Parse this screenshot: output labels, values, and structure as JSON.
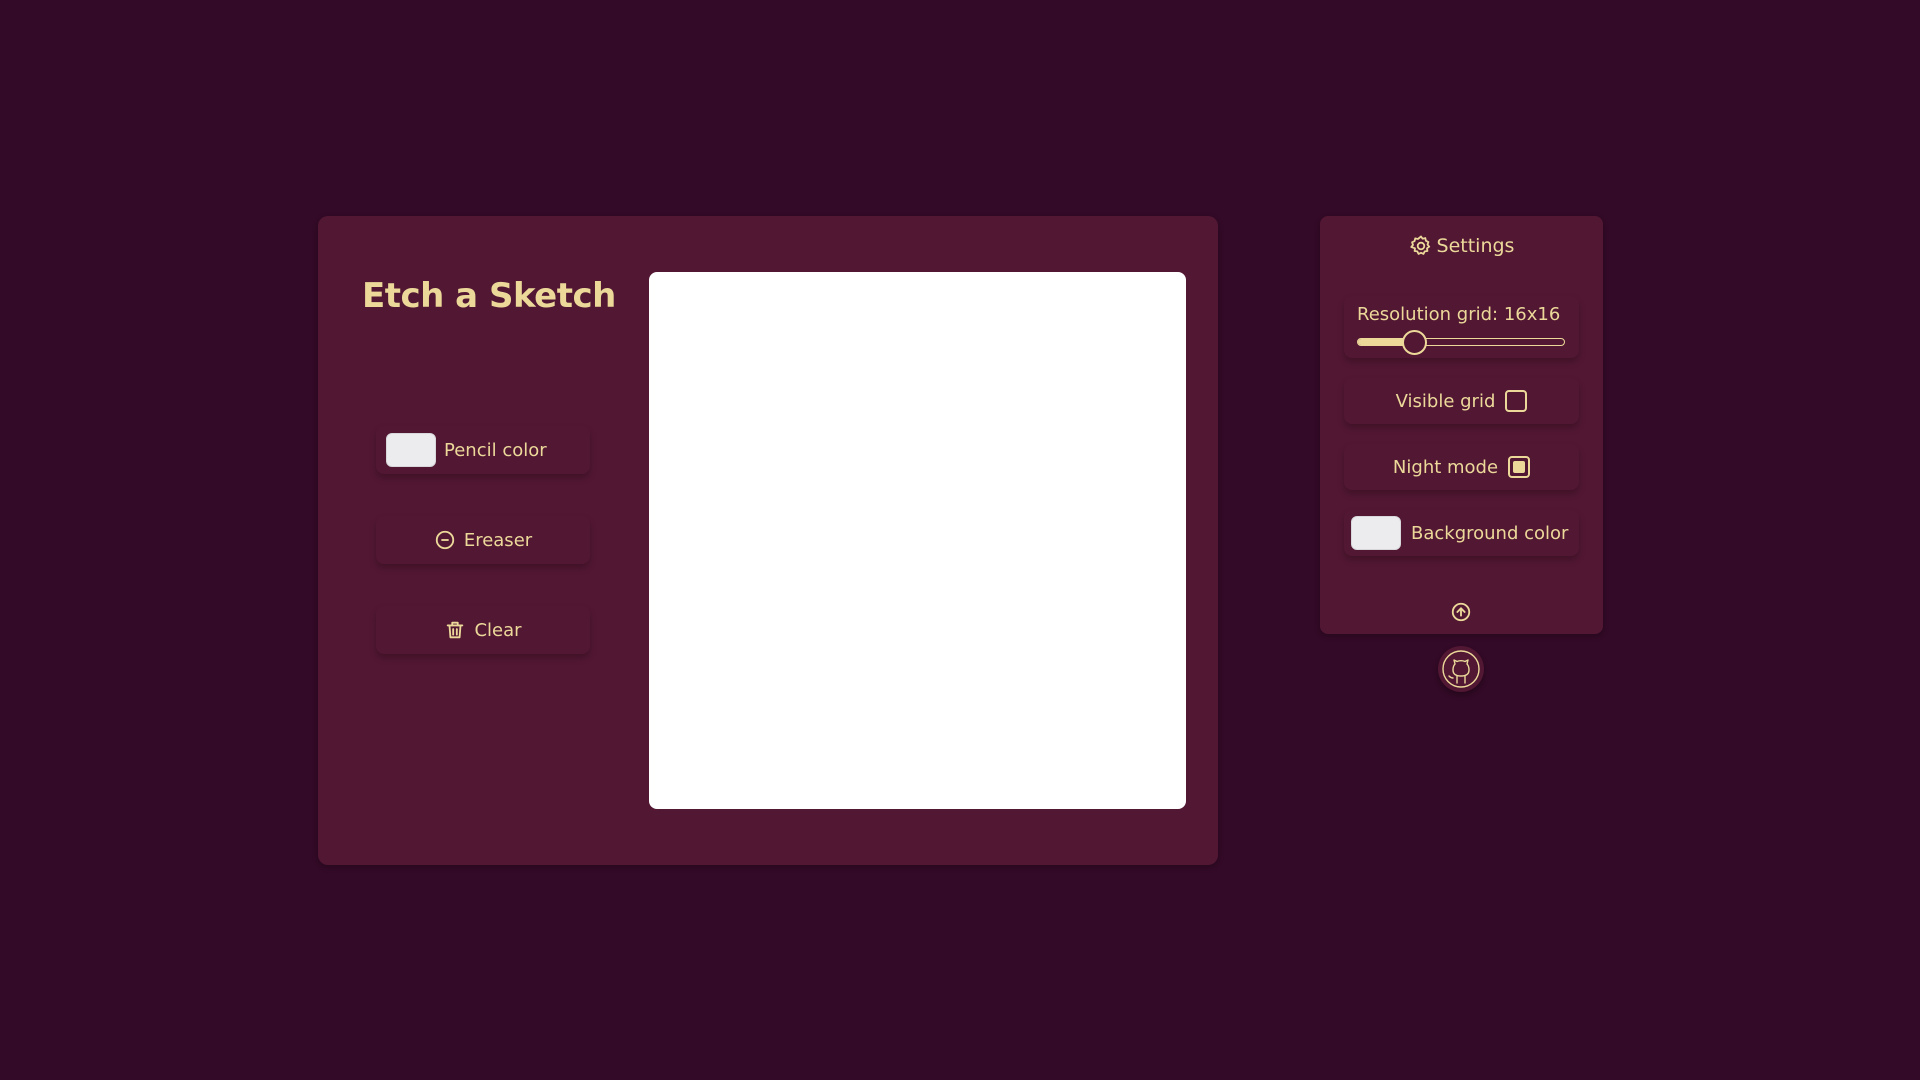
{
  "app": {
    "title": "Etch a Sketch"
  },
  "tools": {
    "pencil_label": "Pencil color",
    "pencil_color": "#ececee",
    "eraser_label": "Ereaser",
    "clear_label": "Clear"
  },
  "canvas": {
    "background": "#ffffff"
  },
  "settings": {
    "title": "Settings",
    "resolution_label": "Resolution grid: 16x16",
    "resolution_slider_fraction": 0.27,
    "visible_grid_label": "Visible grid",
    "visible_grid_checked": false,
    "night_mode_label": "Night mode",
    "night_mode_checked": true,
    "background_color_label": "Background color",
    "background_color": "#ececee"
  },
  "icons": {
    "settings": "gear-icon",
    "eraser": "minus-circle-icon",
    "clear": "trash-icon",
    "collapse": "arrow-up-circle-icon",
    "github": "github-icon"
  },
  "colors": {
    "page_background": "#330a27",
    "panel_background": "#521733",
    "accent": "#ecd99a"
  }
}
